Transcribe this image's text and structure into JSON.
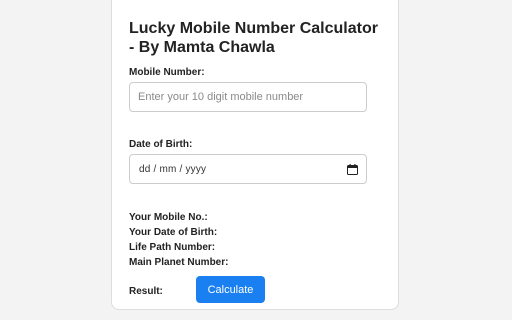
{
  "app": {
    "title_line1": "Lucky Mobile Number Calculator",
    "title_line2": "- By Mamta Chawla"
  },
  "mobile": {
    "label": "Mobile Number:",
    "value": "",
    "placeholder": "Enter your 10 digit mobile number"
  },
  "dob": {
    "label": "Date of Birth:",
    "value_display": "dd / mm / yyyy",
    "icon": "calendar-icon"
  },
  "results": {
    "mobile_label": "Your Mobile No.:",
    "dob_label": "Your Date of Birth:",
    "life_path_label": "Life Path Number:",
    "planet_label": "Main Planet Number:",
    "result_label": "Result:"
  },
  "actions": {
    "calculate_label": "Calculate"
  },
  "colors": {
    "accent": "#1a7ff0",
    "card_bg": "#ffffff",
    "page_bg": "#f3f3f3"
  }
}
